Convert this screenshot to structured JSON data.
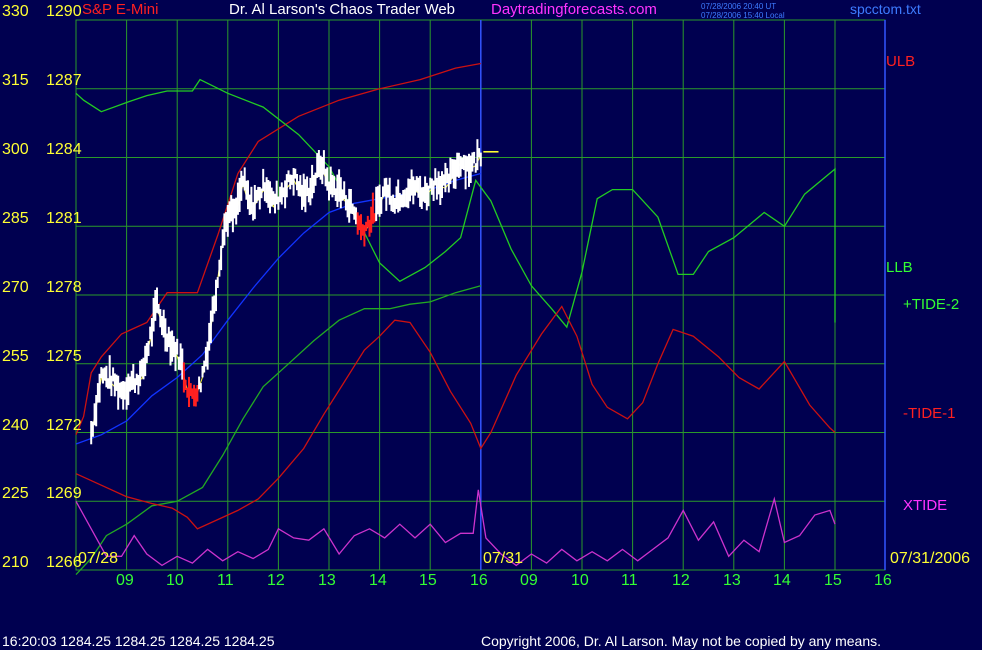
{
  "header": {
    "instrument": "S&P E-Mini",
    "title": "Dr. Al Larson's Chaos Trader Web",
    "site": "Daytradingforecasts.com",
    "timestamp_utc": "07/28/2006 20:40 UT",
    "timestamp_local": "07/28/2006 15:40 Local",
    "filename": "spcctom.txt"
  },
  "footer": {
    "quote": "16:20:03  1284.25 1284.25 1284.25 1284.25",
    "copyright": "Copyright 2006, Dr. Al Larson. May not be copied by any means."
  },
  "colors": {
    "background": "#000050",
    "grid": "#2a9a2a",
    "price_bars": "#ffffff",
    "price_bars_down_cluster": "#ff2020",
    "ulb": "#cc1111",
    "llb": "#22cc22",
    "tide2": "#22aa22",
    "tide1": "#cc1111",
    "xtide": "#cc33cc",
    "moving_average": "#1133ff",
    "fast_average": "#ffff33",
    "divider": "#3355ff",
    "y_labels": "#ffff33",
    "x_labels": "#33ff33"
  },
  "chart_data": {
    "type": "line",
    "y_left_scale": [
      "330",
      "315",
      "300",
      "285",
      "270",
      "255",
      "240",
      "225",
      "210"
    ],
    "y_price_scale": [
      "1290",
      "1287",
      "1284",
      "1281",
      "1278",
      "1275",
      "1272",
      "1269",
      "1266"
    ],
    "ylim_left": [
      210,
      330
    ],
    "ylim_price": [
      1266,
      1290
    ],
    "x_hour_labels": [
      "09",
      "10",
      "11",
      "12",
      "13",
      "14",
      "15",
      "16",
      "09",
      "10",
      "11",
      "12",
      "13",
      "14",
      "15",
      "16"
    ],
    "x_date_labels": [
      "07/28",
      "07/31",
      "07/31/2006"
    ],
    "grid": true,
    "legend": [
      {
        "key": "ulb",
        "label": "ULB"
      },
      {
        "key": "llb",
        "label": "LLB"
      },
      {
        "key": "tide2",
        "label": "+TIDE-2"
      },
      {
        "key": "tide1",
        "label": "-TIDE-1"
      },
      {
        "key": "xtide",
        "label": "XTIDE"
      }
    ],
    "last_price": 1284.25,
    "price_anchors": [
      [
        8.3,
        1272.0
      ],
      [
        8.5,
        1274.5
      ],
      [
        8.7,
        1274.3
      ],
      [
        8.9,
        1273.8
      ],
      [
        9.1,
        1274.2
      ],
      [
        9.3,
        1274.5
      ],
      [
        9.45,
        1276.0
      ],
      [
        9.6,
        1277.6
      ],
      [
        9.75,
        1276.5
      ],
      [
        9.9,
        1275.8
      ],
      [
        10.05,
        1275.3
      ],
      [
        10.25,
        1273.6
      ],
      [
        10.45,
        1274.0
      ],
      [
        10.6,
        1275.7
      ],
      [
        10.75,
        1278.0
      ],
      [
        10.9,
        1280.5
      ],
      [
        11.0,
        1281.5
      ],
      [
        11.15,
        1281.5
      ],
      [
        11.3,
        1283.0
      ],
      [
        11.45,
        1281.8
      ],
      [
        11.6,
        1282.3
      ],
      [
        11.75,
        1282.9
      ],
      [
        11.9,
        1282.0
      ],
      [
        12.1,
        1282.6
      ],
      [
        12.3,
        1283.2
      ],
      [
        12.5,
        1282.3
      ],
      [
        12.7,
        1283.0
      ],
      [
        12.85,
        1283.8
      ],
      [
        13.0,
        1282.8
      ],
      [
        13.2,
        1282.6
      ],
      [
        13.4,
        1282.0
      ],
      [
        13.55,
        1281.4
      ],
      [
        13.65,
        1280.8
      ],
      [
        13.8,
        1281.2
      ],
      [
        13.95,
        1281.8
      ],
      [
        14.1,
        1282.6
      ],
      [
        14.3,
        1282.2
      ],
      [
        14.5,
        1282.5
      ],
      [
        14.7,
        1282.7
      ],
      [
        14.9,
        1282.4
      ],
      [
        15.1,
        1283.0
      ],
      [
        15.3,
        1282.8
      ],
      [
        15.45,
        1283.3
      ],
      [
        15.6,
        1283.9
      ],
      [
        15.75,
        1283.6
      ],
      [
        15.9,
        1283.8
      ],
      [
        16.0,
        1284.25
      ]
    ],
    "red_bar_zones": [
      [
        10.1,
        10.42
      ],
      [
        13.55,
        13.9
      ]
    ],
    "series_points": {
      "ulb": [
        [
          8.0,
          1271.9
        ],
        [
          8.15,
          1272.7
        ],
        [
          8.3,
          1274.6
        ],
        [
          8.5,
          1275.3
        ],
        [
          8.9,
          1276.3
        ],
        [
          9.4,
          1276.8
        ],
        [
          9.8,
          1278.1
        ],
        [
          10.4,
          1278.1
        ],
        [
          10.8,
          1280.6
        ],
        [
          11.2,
          1283.3
        ],
        [
          11.6,
          1284.7
        ],
        [
          12.4,
          1285.8
        ],
        [
          13.2,
          1286.5
        ],
        [
          14.0,
          1287.0
        ],
        [
          14.8,
          1287.4
        ],
        [
          15.5,
          1287.9
        ],
        [
          16.0,
          1288.1
        ]
      ],
      "llb": [
        [
          8.0,
          1286.8
        ],
        [
          8.15,
          1286.5
        ],
        [
          8.5,
          1286.0
        ],
        [
          9.0,
          1286.4
        ],
        [
          9.4,
          1286.7
        ],
        [
          9.8,
          1286.9
        ],
        [
          10.3,
          1286.9
        ],
        [
          10.45,
          1287.4
        ],
        [
          11.0,
          1286.8
        ],
        [
          11.7,
          1286.2
        ],
        [
          12.4,
          1285.0
        ],
        [
          13.0,
          1283.6
        ],
        [
          13.5,
          1281.6
        ],
        [
          14.0,
          1279.4
        ],
        [
          14.4,
          1278.6
        ],
        [
          14.9,
          1279.2
        ],
        [
          15.3,
          1279.9
        ],
        [
          15.6,
          1280.5
        ],
        [
          15.9,
          1283.0
        ],
        [
          16.2,
          1282.1
        ],
        [
          16.6,
          1280.0
        ],
        [
          17.0,
          1278.4
        ],
        [
          17.4,
          1277.4
        ],
        [
          17.7,
          1276.6
        ],
        [
          18.0,
          1279.0
        ],
        [
          18.3,
          1282.2
        ],
        [
          18.6,
          1282.6
        ],
        [
          19.0,
          1282.6
        ],
        [
          19.5,
          1281.4
        ],
        [
          19.9,
          1278.9
        ],
        [
          20.2,
          1278.9
        ],
        [
          20.5,
          1279.9
        ],
        [
          21.0,
          1280.5
        ],
        [
          21.6,
          1281.6
        ],
        [
          22.0,
          1281.0
        ],
        [
          22.4,
          1282.4
        ],
        [
          23.0,
          1283.5
        ],
        [
          23.0,
          1276.8
        ]
      ],
      "tide2": [
        [
          8.0,
          1265.8
        ],
        [
          8.3,
          1266.5
        ],
        [
          8.6,
          1267.5
        ],
        [
          9.0,
          1268.0
        ],
        [
          9.5,
          1268.8
        ],
        [
          10.0,
          1269.0
        ],
        [
          10.5,
          1269.6
        ],
        [
          10.9,
          1271.0
        ],
        [
          11.3,
          1272.6
        ],
        [
          11.7,
          1274.0
        ],
        [
          12.2,
          1275.0
        ],
        [
          12.7,
          1276.0
        ],
        [
          13.2,
          1276.9
        ],
        [
          13.7,
          1277.4
        ],
        [
          14.2,
          1277.4
        ],
        [
          14.6,
          1277.6
        ],
        [
          15.0,
          1277.7
        ],
        [
          15.5,
          1278.1
        ],
        [
          16.0,
          1278.4
        ]
      ],
      "tide1": [
        [
          8.0,
          1270.2
        ],
        [
          8.5,
          1269.7
        ],
        [
          9.0,
          1269.2
        ],
        [
          9.5,
          1268.9
        ],
        [
          9.9,
          1268.7
        ],
        [
          10.2,
          1268.3
        ],
        [
          10.4,
          1267.8
        ],
        [
          10.8,
          1268.2
        ],
        [
          11.2,
          1268.6
        ],
        [
          11.6,
          1269.1
        ],
        [
          12.0,
          1270.0
        ],
        [
          12.5,
          1271.3
        ],
        [
          12.9,
          1272.8
        ],
        [
          13.3,
          1274.2
        ],
        [
          13.7,
          1275.6
        ],
        [
          14.0,
          1276.2
        ],
        [
          14.3,
          1276.9
        ],
        [
          14.6,
          1276.8
        ],
        [
          15.0,
          1275.5
        ],
        [
          15.4,
          1273.8
        ],
        [
          15.8,
          1272.4
        ],
        [
          16.0,
          1271.3
        ],
        [
          16.2,
          1272.0
        ],
        [
          16.7,
          1274.5
        ],
        [
          17.2,
          1276.3
        ],
        [
          17.6,
          1277.5
        ],
        [
          17.9,
          1276.2
        ],
        [
          18.2,
          1274.1
        ],
        [
          18.5,
          1273.1
        ],
        [
          18.9,
          1272.6
        ],
        [
          19.2,
          1273.3
        ],
        [
          19.5,
          1275.0
        ],
        [
          19.8,
          1276.5
        ],
        [
          20.2,
          1276.2
        ],
        [
          20.7,
          1275.3
        ],
        [
          21.1,
          1274.4
        ],
        [
          21.5,
          1273.9
        ],
        [
          22.0,
          1275.1
        ],
        [
          22.5,
          1273.2
        ],
        [
          22.9,
          1272.2
        ],
        [
          23.0,
          1272.0
        ]
      ],
      "xtide": [
        [
          8.0,
          1269.0
        ],
        [
          8.3,
          1267.8
        ],
        [
          8.6,
          1266.6
        ],
        [
          8.9,
          1266.6
        ],
        [
          9.15,
          1267.5
        ],
        [
          9.4,
          1266.7
        ],
        [
          9.7,
          1266.2
        ],
        [
          10.0,
          1266.6
        ],
        [
          10.3,
          1266.3
        ],
        [
          10.6,
          1266.9
        ],
        [
          10.9,
          1266.4
        ],
        [
          11.2,
          1266.8
        ],
        [
          11.5,
          1266.5
        ],
        [
          11.8,
          1266.9
        ],
        [
          12.0,
          1267.8
        ],
        [
          12.3,
          1267.4
        ],
        [
          12.6,
          1267.3
        ],
        [
          12.9,
          1267.8
        ],
        [
          13.2,
          1266.7
        ],
        [
          13.5,
          1267.5
        ],
        [
          13.8,
          1267.8
        ],
        [
          14.1,
          1267.4
        ],
        [
          14.4,
          1268.0
        ],
        [
          14.7,
          1267.4
        ],
        [
          15.0,
          1268.0
        ],
        [
          15.3,
          1267.2
        ],
        [
          15.6,
          1267.6
        ],
        [
          15.85,
          1267.6
        ],
        [
          15.95,
          1269.5
        ],
        [
          16.1,
          1267.4
        ],
        [
          16.4,
          1266.7
        ],
        [
          16.7,
          1266.2
        ],
        [
          17.0,
          1266.7
        ],
        [
          17.3,
          1266.3
        ],
        [
          17.6,
          1266.9
        ],
        [
          17.9,
          1266.4
        ],
        [
          18.2,
          1266.8
        ],
        [
          18.5,
          1266.4
        ],
        [
          18.8,
          1266.9
        ],
        [
          19.1,
          1266.4
        ],
        [
          19.4,
          1266.9
        ],
        [
          19.7,
          1267.4
        ],
        [
          20.0,
          1268.6
        ],
        [
          20.3,
          1267.3
        ],
        [
          20.6,
          1268.1
        ],
        [
          20.9,
          1266.6
        ],
        [
          21.2,
          1267.3
        ],
        [
          21.5,
          1266.8
        ],
        [
          21.8,
          1269.1
        ],
        [
          22.0,
          1267.2
        ],
        [
          22.3,
          1267.5
        ],
        [
          22.6,
          1268.4
        ],
        [
          22.9,
          1268.6
        ],
        [
          23.0,
          1268.0
        ]
      ],
      "ma_blue": [
        [
          8.0,
          1271.5
        ],
        [
          8.5,
          1271.9
        ],
        [
          9.0,
          1272.5
        ],
        [
          9.5,
          1273.6
        ],
        [
          10.0,
          1274.4
        ],
        [
          10.5,
          1275.4
        ],
        [
          11.0,
          1276.9
        ],
        [
          11.5,
          1278.3
        ],
        [
          12.0,
          1279.6
        ],
        [
          12.5,
          1280.7
        ],
        [
          13.0,
          1281.6
        ],
        [
          13.5,
          1282.0
        ],
        [
          14.0,
          1282.2
        ],
        [
          14.5,
          1282.4
        ],
        [
          15.0,
          1282.6
        ],
        [
          15.5,
          1283.0
        ],
        [
          16.0,
          1283.3
        ]
      ]
    }
  }
}
